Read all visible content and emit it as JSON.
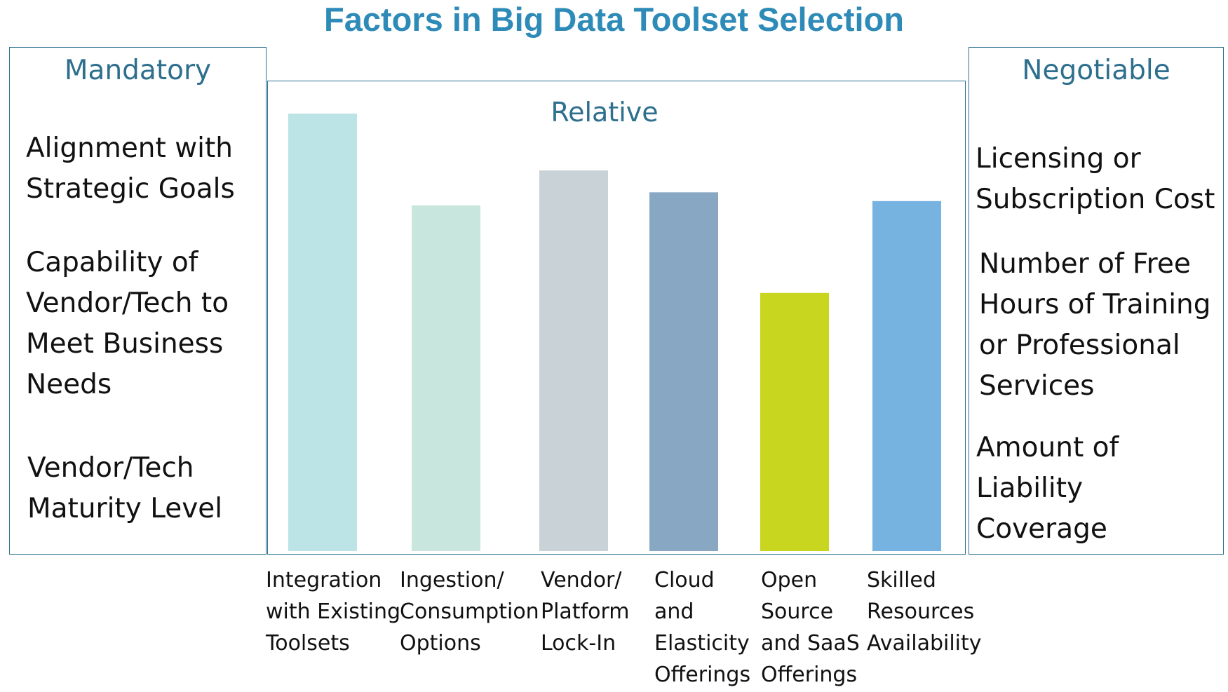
{
  "colors": {
    "title": "#2e8bb8",
    "heading": "#2e6f8e",
    "border": "#2e6f8e",
    "bars": [
      "#bce3e6",
      "#c8e6dd",
      "#c9d2d6",
      "#87a7c2",
      "#c8d620",
      "#77b3e1"
    ]
  },
  "title": "Factors in Big Data Toolset Selection",
  "mandatory": {
    "heading": "Mandatory",
    "items": [
      "Alignment with\nStrategic Goals",
      "Capability of\nVendor/Tech to\nMeet Business\nNeeds",
      "Vendor/Tech\nMaturity Level"
    ]
  },
  "negotiable": {
    "heading": "Negotiable",
    "items": [
      "Licensing or\nSubscription Cost",
      "Number of Free\nHours of Training\nor Professional\nServices",
      "Amount of\nLiability\nCoverage"
    ]
  },
  "chart_data": {
    "type": "bar",
    "title": "Relative",
    "xlabel": "",
    "ylabel": "",
    "ylim": [
      0,
      100
    ],
    "grid": false,
    "categories": [
      "Integration\nwith Existing\nToolsets",
      "Ingestion/\nConsumption\nOptions",
      "Vendor/\nPlatform\nLock-In",
      "Cloud\nand\nElasticity\nOfferings",
      "Open\nSource\nand SaaS\nOfferings",
      "Skilled\nResources\nAvailability"
    ],
    "values": [
      100,
      79,
      87,
      82,
      59,
      80
    ]
  }
}
